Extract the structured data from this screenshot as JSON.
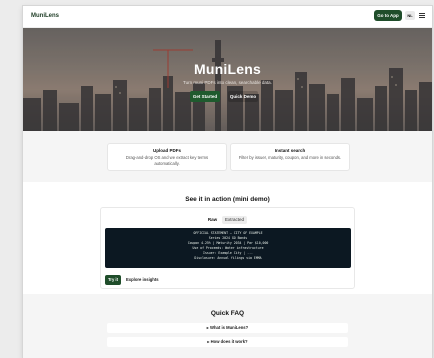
{
  "header": {
    "brand": "MuniLens",
    "go_to_app": "Go to App",
    "lang": "NL",
    "menu_icon": "hamburger-menu-icon"
  },
  "hero": {
    "title": "MuniLens",
    "subtitle": "Turn muni PDFs into clean, searchable data.",
    "get_started": "Get Started",
    "quick_demo": "Quick Demo",
    "background": "city-skyline-photo"
  },
  "features": [
    {
      "title": "Upload PDFs",
      "text": "Drag-and-drop OS and we extract key terms automatically."
    },
    {
      "title": "Instant search",
      "text": "Filter by issuer, maturity, coupon, and more in seconds."
    }
  ],
  "demo": {
    "title": "See it in action (mini demo)",
    "tabs": [
      "Raw",
      "Extracted"
    ],
    "active_tab": "Raw",
    "terminal_lines": [
      "OFFICIAL STATEMENT — CITY OF EXAMPLE",
      "Series 2024 GO Bonds",
      "Coupon 4.25% | Maturity 2034 | Par $10,000",
      "Use of Proceeds: Water infrastructure",
      "Issuer: Example City | ...",
      "Disclosure: Annual filings via EMMA"
    ],
    "try_it": "Try it",
    "explore": "Explore insights"
  },
  "faq": {
    "title": "Quick FAQ",
    "items": [
      "▸ What is MuniLens?",
      "▸ How does it work?"
    ]
  },
  "colors": {
    "brand_green": "#1f4d2a",
    "terminal_bg": "#0c1822"
  }
}
